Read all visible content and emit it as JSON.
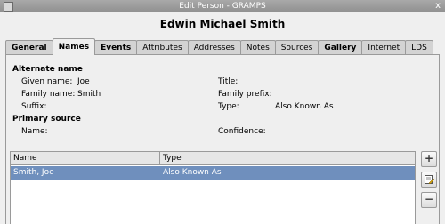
{
  "window": {
    "title": "Edit Person - GRAMPS",
    "close_glyph": "x"
  },
  "header": {
    "person_name": "Edwin Michael Smith"
  },
  "tabs": [
    {
      "label": "General",
      "bold": true
    },
    {
      "label": "Names",
      "bold": true,
      "active": true
    },
    {
      "label": "Events",
      "bold": true
    },
    {
      "label": "Attributes",
      "bold": false
    },
    {
      "label": "Addresses",
      "bold": false
    },
    {
      "label": "Notes",
      "bold": false
    },
    {
      "label": "Sources",
      "bold": false
    },
    {
      "label": "Gallery",
      "bold": true
    },
    {
      "label": "Internet",
      "bold": false
    },
    {
      "label": "LDS",
      "bold": false
    }
  ],
  "alternate_name": {
    "heading": "Alternate name",
    "given_name_label": "Given name:",
    "given_name_value": "Joe",
    "family_name_label": "Family name:",
    "family_name_value": "Smith",
    "suffix_label": "Suffix:",
    "suffix_value": "",
    "title_label": "Title:",
    "title_value": "",
    "family_prefix_label": "Family prefix:",
    "family_prefix_value": "",
    "type_label": "Type:",
    "type_value": "Also Known As"
  },
  "primary_source": {
    "heading": "Primary source",
    "name_label": "Name:",
    "name_value": "",
    "confidence_label": "Confidence:",
    "confidence_value": ""
  },
  "names_list": {
    "columns": [
      "Name",
      "Type"
    ],
    "rows": [
      {
        "name": "Smith, Joe",
        "type": "Also Known As",
        "selected": true
      }
    ]
  },
  "buttons": {
    "add": "+",
    "remove": "−"
  },
  "colors": {
    "selection": "#6f8fbd",
    "titlebar": "#9a9a9a"
  }
}
